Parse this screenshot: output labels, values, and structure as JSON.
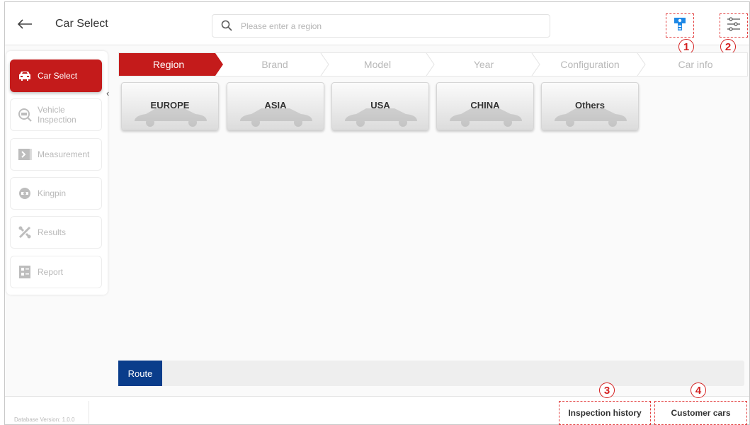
{
  "header": {
    "title": "Car Select",
    "search_placeholder": "Please enter a region",
    "callouts": [
      "1",
      "2",
      "3",
      "4"
    ]
  },
  "sidebar": {
    "items": [
      {
        "label": "Car Select",
        "icon": "car-icon",
        "active": true
      },
      {
        "label": "Vehicle Inspection",
        "icon": "inspection-icon",
        "active": false
      },
      {
        "label": "Measurement",
        "icon": "measurement-icon",
        "active": false
      },
      {
        "label": "Kingpin",
        "icon": "kingpin-icon",
        "active": false
      },
      {
        "label": "Results",
        "icon": "results-icon",
        "active": false
      },
      {
        "label": "Report",
        "icon": "report-icon",
        "active": false
      }
    ],
    "collapse_glyph": "‹"
  },
  "steps": [
    "Region",
    "Brand",
    "Model",
    "Year",
    "Configuration",
    "Car info"
  ],
  "regions": [
    "EUROPE",
    "ASIA",
    "USA",
    "CHINA",
    "Others"
  ],
  "route": {
    "label": "Route"
  },
  "footer": {
    "db_version": "Database Version: 1.0.0",
    "inspection_history": "Inspection history",
    "customer_cars": "Customer cars"
  },
  "colors": {
    "accent": "#c41b1b",
    "route": "#0a3d8b",
    "callout": "#d42020",
    "icon_blue": "#1e88e5"
  }
}
